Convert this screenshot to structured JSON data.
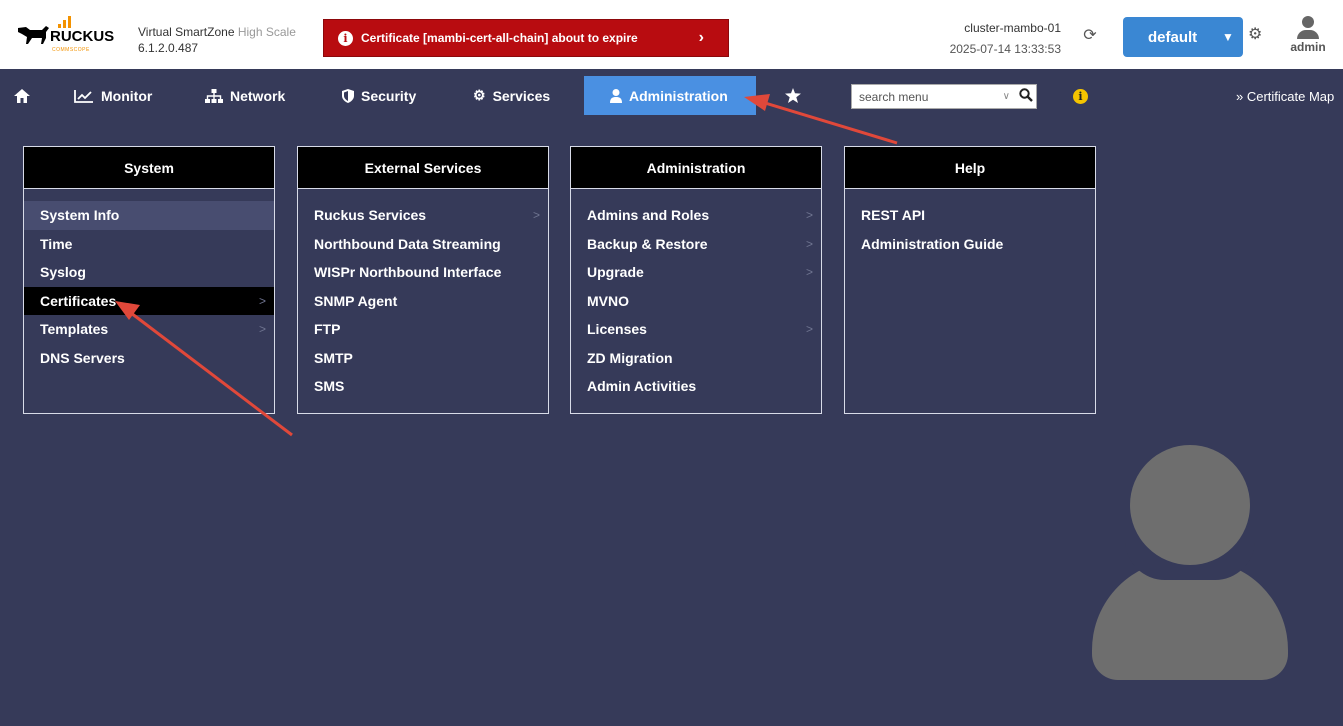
{
  "header": {
    "brand": "RUCKUS",
    "brand_sub": "COMMSCOPE",
    "product_name": "Virtual SmartZone",
    "product_edition": "High Scale",
    "version": "6.1.2.0.487",
    "alert_text": "Certificate [mambi-cert-all-chain] about to expire",
    "cluster_name": "cluster-mambo-01",
    "timestamp": "2025-07-14 13:33:53",
    "domain_label": "default",
    "user_name": "admin"
  },
  "nav": {
    "monitor": "Monitor",
    "network": "Network",
    "security": "Security",
    "services": "Services",
    "administration": "Administration",
    "search_placeholder": "search menu",
    "breadcrumb": "» Certificate Map"
  },
  "menu": {
    "system": {
      "title": "System",
      "items": [
        "System Info",
        "Time",
        "Syslog",
        "Certificates",
        "Templates",
        "DNS Servers"
      ]
    },
    "external": {
      "title": "External Services",
      "items": [
        "Ruckus Services",
        "Northbound Data Streaming",
        "WISPr Northbound Interface",
        "SNMP Agent",
        "FTP",
        "SMTP",
        "SMS"
      ]
    },
    "administration": {
      "title": "Administration",
      "items": [
        "Admins and Roles",
        "Backup & Restore",
        "Upgrade",
        "MVNO",
        "Licenses",
        "ZD Migration",
        "Admin Activities"
      ]
    },
    "help": {
      "title": "Help",
      "items": [
        "REST API",
        "Administration Guide"
      ]
    }
  },
  "colors": {
    "background": "#363a59",
    "active_tab": "#4a90e2",
    "alert": "#b80c10",
    "domain_button": "#3a87d3",
    "annotation_arrow": "#e0483a"
  }
}
